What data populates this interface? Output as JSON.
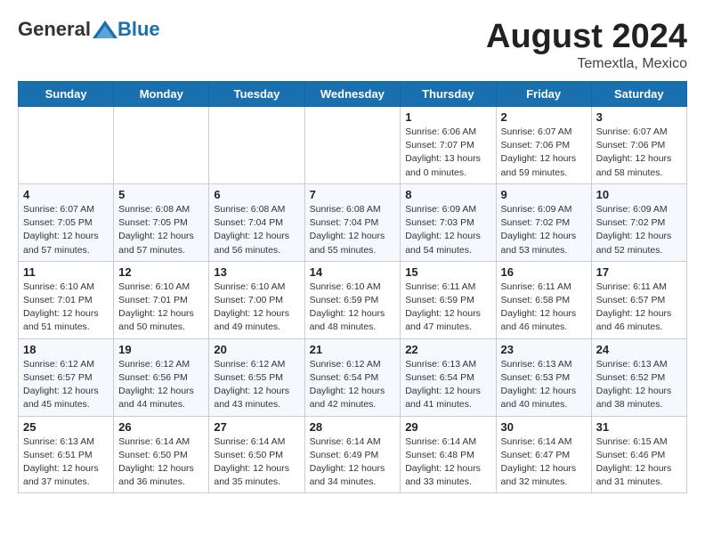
{
  "header": {
    "logo_general": "General",
    "logo_blue": "Blue",
    "title": "August 2024",
    "location": "Temextla, Mexico"
  },
  "weekdays": [
    "Sunday",
    "Monday",
    "Tuesday",
    "Wednesday",
    "Thursday",
    "Friday",
    "Saturday"
  ],
  "weeks": [
    [
      {
        "day": "",
        "info": ""
      },
      {
        "day": "",
        "info": ""
      },
      {
        "day": "",
        "info": ""
      },
      {
        "day": "",
        "info": ""
      },
      {
        "day": "1",
        "info": "Sunrise: 6:06 AM\nSunset: 7:07 PM\nDaylight: 13 hours\nand 0 minutes."
      },
      {
        "day": "2",
        "info": "Sunrise: 6:07 AM\nSunset: 7:06 PM\nDaylight: 12 hours\nand 59 minutes."
      },
      {
        "day": "3",
        "info": "Sunrise: 6:07 AM\nSunset: 7:06 PM\nDaylight: 12 hours\nand 58 minutes."
      }
    ],
    [
      {
        "day": "4",
        "info": "Sunrise: 6:07 AM\nSunset: 7:05 PM\nDaylight: 12 hours\nand 57 minutes."
      },
      {
        "day": "5",
        "info": "Sunrise: 6:08 AM\nSunset: 7:05 PM\nDaylight: 12 hours\nand 57 minutes."
      },
      {
        "day": "6",
        "info": "Sunrise: 6:08 AM\nSunset: 7:04 PM\nDaylight: 12 hours\nand 56 minutes."
      },
      {
        "day": "7",
        "info": "Sunrise: 6:08 AM\nSunset: 7:04 PM\nDaylight: 12 hours\nand 55 minutes."
      },
      {
        "day": "8",
        "info": "Sunrise: 6:09 AM\nSunset: 7:03 PM\nDaylight: 12 hours\nand 54 minutes."
      },
      {
        "day": "9",
        "info": "Sunrise: 6:09 AM\nSunset: 7:02 PM\nDaylight: 12 hours\nand 53 minutes."
      },
      {
        "day": "10",
        "info": "Sunrise: 6:09 AM\nSunset: 7:02 PM\nDaylight: 12 hours\nand 52 minutes."
      }
    ],
    [
      {
        "day": "11",
        "info": "Sunrise: 6:10 AM\nSunset: 7:01 PM\nDaylight: 12 hours\nand 51 minutes."
      },
      {
        "day": "12",
        "info": "Sunrise: 6:10 AM\nSunset: 7:01 PM\nDaylight: 12 hours\nand 50 minutes."
      },
      {
        "day": "13",
        "info": "Sunrise: 6:10 AM\nSunset: 7:00 PM\nDaylight: 12 hours\nand 49 minutes."
      },
      {
        "day": "14",
        "info": "Sunrise: 6:10 AM\nSunset: 6:59 PM\nDaylight: 12 hours\nand 48 minutes."
      },
      {
        "day": "15",
        "info": "Sunrise: 6:11 AM\nSunset: 6:59 PM\nDaylight: 12 hours\nand 47 minutes."
      },
      {
        "day": "16",
        "info": "Sunrise: 6:11 AM\nSunset: 6:58 PM\nDaylight: 12 hours\nand 46 minutes."
      },
      {
        "day": "17",
        "info": "Sunrise: 6:11 AM\nSunset: 6:57 PM\nDaylight: 12 hours\nand 46 minutes."
      }
    ],
    [
      {
        "day": "18",
        "info": "Sunrise: 6:12 AM\nSunset: 6:57 PM\nDaylight: 12 hours\nand 45 minutes."
      },
      {
        "day": "19",
        "info": "Sunrise: 6:12 AM\nSunset: 6:56 PM\nDaylight: 12 hours\nand 44 minutes."
      },
      {
        "day": "20",
        "info": "Sunrise: 6:12 AM\nSunset: 6:55 PM\nDaylight: 12 hours\nand 43 minutes."
      },
      {
        "day": "21",
        "info": "Sunrise: 6:12 AM\nSunset: 6:54 PM\nDaylight: 12 hours\nand 42 minutes."
      },
      {
        "day": "22",
        "info": "Sunrise: 6:13 AM\nSunset: 6:54 PM\nDaylight: 12 hours\nand 41 minutes."
      },
      {
        "day": "23",
        "info": "Sunrise: 6:13 AM\nSunset: 6:53 PM\nDaylight: 12 hours\nand 40 minutes."
      },
      {
        "day": "24",
        "info": "Sunrise: 6:13 AM\nSunset: 6:52 PM\nDaylight: 12 hours\nand 38 minutes."
      }
    ],
    [
      {
        "day": "25",
        "info": "Sunrise: 6:13 AM\nSunset: 6:51 PM\nDaylight: 12 hours\nand 37 minutes."
      },
      {
        "day": "26",
        "info": "Sunrise: 6:14 AM\nSunset: 6:50 PM\nDaylight: 12 hours\nand 36 minutes."
      },
      {
        "day": "27",
        "info": "Sunrise: 6:14 AM\nSunset: 6:50 PM\nDaylight: 12 hours\nand 35 minutes."
      },
      {
        "day": "28",
        "info": "Sunrise: 6:14 AM\nSunset: 6:49 PM\nDaylight: 12 hours\nand 34 minutes."
      },
      {
        "day": "29",
        "info": "Sunrise: 6:14 AM\nSunset: 6:48 PM\nDaylight: 12 hours\nand 33 minutes."
      },
      {
        "day": "30",
        "info": "Sunrise: 6:14 AM\nSunset: 6:47 PM\nDaylight: 12 hours\nand 32 minutes."
      },
      {
        "day": "31",
        "info": "Sunrise: 6:15 AM\nSunset: 6:46 PM\nDaylight: 12 hours\nand 31 minutes."
      }
    ]
  ]
}
